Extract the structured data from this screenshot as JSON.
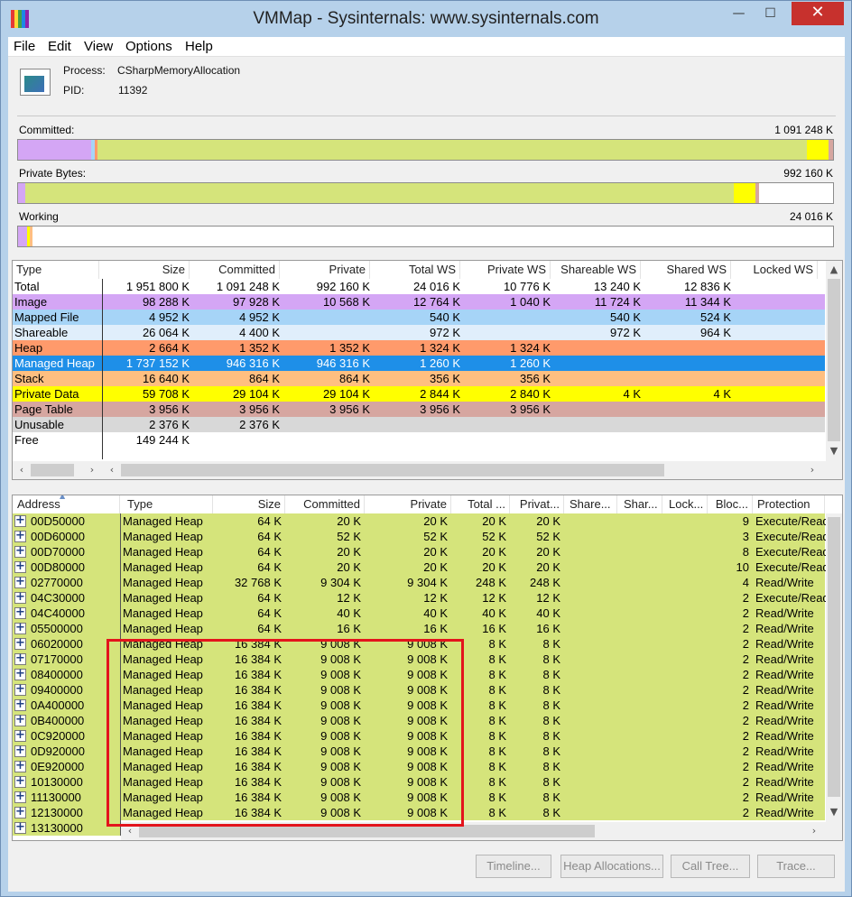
{
  "window": {
    "title": "VMMap - Sysinternals: www.sysinternals.com",
    "minimize": "—",
    "maximize": "☐",
    "close": "✕"
  },
  "menu": [
    "File",
    "Edit",
    "View",
    "Options",
    "Help"
  ],
  "process": {
    "process_label": "Process:",
    "process_value": "CSharpMemoryAllocation",
    "pid_label": "PID:",
    "pid_value": "11392"
  },
  "bars": {
    "committed_label": "Committed:",
    "committed_value": "1 091 248 K",
    "private_label": "Private Bytes:",
    "private_value": "992 160 K",
    "working_label": "Working",
    "working_value": "24 016 K"
  },
  "colors": {
    "image": "#d4a6f5",
    "mapped": "#a6d4f7",
    "shareable": "#e0eefb",
    "heap": "#ff9a6b",
    "managed": "#1e8fe8",
    "stack": "#ffbf80",
    "private": "#ffff00",
    "pagetable": "#d6a6a0",
    "unusable": "#d8d8d8",
    "free": "#ffffff",
    "managed_bar": "#d5e47b",
    "detail_row": "#d5e47b"
  },
  "summary": {
    "headers": [
      "Type",
      "Size",
      "Committed",
      "Private",
      "Total WS",
      "Private WS",
      "Shareable WS",
      "Shared WS",
      "Locked WS"
    ],
    "rows": [
      {
        "type": "Total",
        "c": [
          "1 951 800 K",
          "1 091 248 K",
          "992 160 K",
          "24 016 K",
          "10 776 K",
          "13 240 K",
          "12 836 K",
          ""
        ],
        "color": "#ffffff"
      },
      {
        "type": "Image",
        "c": [
          "98 288 K",
          "97 928 K",
          "10 568 K",
          "12 764 K",
          "1 040 K",
          "11 724 K",
          "11 344 K",
          ""
        ],
        "color": "#d4a6f5"
      },
      {
        "type": "Mapped File",
        "c": [
          "4 952 K",
          "4 952 K",
          "",
          "540 K",
          "",
          "540 K",
          "524 K",
          ""
        ],
        "color": "#a6d4f7"
      },
      {
        "type": "Shareable",
        "c": [
          "26 064 K",
          "4 400 K",
          "",
          "972 K",
          "",
          "972 K",
          "964 K",
          ""
        ],
        "color": "#e0eefb"
      },
      {
        "type": "Heap",
        "c": [
          "2 664 K",
          "1 352 K",
          "1 352 K",
          "1 324 K",
          "1 324 K",
          "",
          "",
          ""
        ],
        "color": "#ff9a6b"
      },
      {
        "type": "Managed Heap",
        "c": [
          "1 737 152 K",
          "946 316 K",
          "946 316 K",
          "1 260 K",
          "1 260 K",
          "",
          "",
          ""
        ],
        "color": "#1e8fe8"
      },
      {
        "type": "Stack",
        "c": [
          "16 640 K",
          "864 K",
          "864 K",
          "356 K",
          "356 K",
          "",
          "",
          ""
        ],
        "color": "#ffbf80"
      },
      {
        "type": "Private Data",
        "c": [
          "59 708 K",
          "29 104 K",
          "29 104 K",
          "2 844 K",
          "2 840 K",
          "4 K",
          "4 K",
          ""
        ],
        "color": "#ffff00"
      },
      {
        "type": "Page Table",
        "c": [
          "3 956 K",
          "3 956 K",
          "3 956 K",
          "3 956 K",
          "3 956 K",
          "",
          "",
          ""
        ],
        "color": "#d6a6a0"
      },
      {
        "type": "Unusable",
        "c": [
          "2 376 K",
          "2 376 K",
          "",
          "",
          "",
          "",
          "",
          ""
        ],
        "color": "#d8d8d8"
      },
      {
        "type": "Free",
        "c": [
          "149 244 K",
          "",
          "",
          "",
          "",
          "",
          "",
          ""
        ],
        "color": "#ffffff"
      }
    ]
  },
  "detail": {
    "headers": [
      "Address",
      "Type",
      "Size",
      "Committed",
      "Private",
      "Total ...",
      "Privat...",
      "Share...",
      "Shar...",
      "Lock...",
      "Bloc...",
      "Protection"
    ],
    "rows": [
      [
        "00D50000",
        "Managed Heap",
        "64 K",
        "20 K",
        "20 K",
        "20 K",
        "20 K",
        "",
        "",
        "",
        "9",
        "Execute/Read"
      ],
      [
        "00D60000",
        "Managed Heap",
        "64 K",
        "52 K",
        "52 K",
        "52 K",
        "52 K",
        "",
        "",
        "",
        "3",
        "Execute/Read"
      ],
      [
        "00D70000",
        "Managed Heap",
        "64 K",
        "20 K",
        "20 K",
        "20 K",
        "20 K",
        "",
        "",
        "",
        "8",
        "Execute/Read"
      ],
      [
        "00D80000",
        "Managed Heap",
        "64 K",
        "20 K",
        "20 K",
        "20 K",
        "20 K",
        "",
        "",
        "",
        "10",
        "Execute/Read"
      ],
      [
        "02770000",
        "Managed Heap",
        "32 768 K",
        "9 304 K",
        "9 304 K",
        "248 K",
        "248 K",
        "",
        "",
        "",
        "4",
        "Read/Write"
      ],
      [
        "04C30000",
        "Managed Heap",
        "64 K",
        "12 K",
        "12 K",
        "12 K",
        "12 K",
        "",
        "",
        "",
        "2",
        "Execute/Read"
      ],
      [
        "04C40000",
        "Managed Heap",
        "64 K",
        "40 K",
        "40 K",
        "40 K",
        "40 K",
        "",
        "",
        "",
        "2",
        "Read/Write"
      ],
      [
        "05500000",
        "Managed Heap",
        "64 K",
        "16 K",
        "16 K",
        "16 K",
        "16 K",
        "",
        "",
        "",
        "2",
        "Read/Write"
      ],
      [
        "06020000",
        "Managed Heap",
        "16 384 K",
        "9 008 K",
        "9 008 K",
        "8 K",
        "8 K",
        "",
        "",
        "",
        "2",
        "Read/Write"
      ],
      [
        "07170000",
        "Managed Heap",
        "16 384 K",
        "9 008 K",
        "9 008 K",
        "8 K",
        "8 K",
        "",
        "",
        "",
        "2",
        "Read/Write"
      ],
      [
        "08400000",
        "Managed Heap",
        "16 384 K",
        "9 008 K",
        "9 008 K",
        "8 K",
        "8 K",
        "",
        "",
        "",
        "2",
        "Read/Write"
      ],
      [
        "09400000",
        "Managed Heap",
        "16 384 K",
        "9 008 K",
        "9 008 K",
        "8 K",
        "8 K",
        "",
        "",
        "",
        "2",
        "Read/Write"
      ],
      [
        "0A400000",
        "Managed Heap",
        "16 384 K",
        "9 008 K",
        "9 008 K",
        "8 K",
        "8 K",
        "",
        "",
        "",
        "2",
        "Read/Write"
      ],
      [
        "0B400000",
        "Managed Heap",
        "16 384 K",
        "9 008 K",
        "9 008 K",
        "8 K",
        "8 K",
        "",
        "",
        "",
        "2",
        "Read/Write"
      ],
      [
        "0C920000",
        "Managed Heap",
        "16 384 K",
        "9 008 K",
        "9 008 K",
        "8 K",
        "8 K",
        "",
        "",
        "",
        "2",
        "Read/Write"
      ],
      [
        "0D920000",
        "Managed Heap",
        "16 384 K",
        "9 008 K",
        "9 008 K",
        "8 K",
        "8 K",
        "",
        "",
        "",
        "2",
        "Read/Write"
      ],
      [
        "0E920000",
        "Managed Heap",
        "16 384 K",
        "9 008 K",
        "9 008 K",
        "8 K",
        "8 K",
        "",
        "",
        "",
        "2",
        "Read/Write"
      ],
      [
        "10130000",
        "Managed Heap",
        "16 384 K",
        "9 008 K",
        "9 008 K",
        "8 K",
        "8 K",
        "",
        "",
        "",
        "2",
        "Read/Write"
      ],
      [
        "11130000",
        "Managed Heap",
        "16 384 K",
        "9 008 K",
        "9 008 K",
        "8 K",
        "8 K",
        "",
        "",
        "",
        "2",
        "Read/Write"
      ],
      [
        "12130000",
        "Managed Heap",
        "16 384 K",
        "9 008 K",
        "9 008 K",
        "8 K",
        "8 K",
        "",
        "",
        "",
        "2",
        "Read/Write"
      ],
      [
        "13130000",
        "",
        "",
        "",
        "",
        "",
        "",
        "",
        "",
        "",
        "",
        ""
      ]
    ]
  },
  "buttons": [
    "Timeline...",
    "Heap Allocations...",
    "Call Tree...",
    "Trace..."
  ]
}
